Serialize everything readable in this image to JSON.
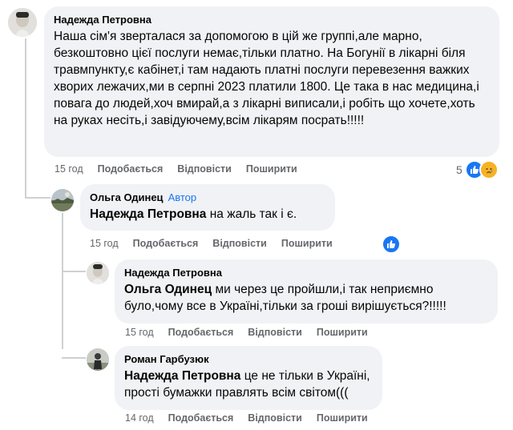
{
  "comments": [
    {
      "author": "Надежда Петровна",
      "text": "Наша сім'я зверталася за допомогою в цій же группі,але марно, безкоштовно цієї послуги немає,тільки платно. На Богунії в лікарні біля травмпункту,є кабінет,і там надають платні послуги перевезення важких хворих лежачих,ми в серпні 2023 платили 1800. Це така в нас медицина,і повага до людей,хоч вмирай,а з лікарні виписали,і робіть що хочете,хоть на руках несіть,і завідуючему,всім лікарям посрать!!!!!",
      "time": "15 год",
      "like": "Подобається",
      "reply": "Відповісти",
      "share": "Поширити",
      "reaction_count": "5"
    },
    {
      "author": "Ольга Одинец",
      "badge": "Автор",
      "mention": "Надежда Петровна",
      "text": " на жаль так і є.",
      "time": "15 год",
      "like": "Подобається",
      "reply": "Відповісти",
      "share": "Поширити"
    },
    {
      "author": "Надежда Петровна",
      "mention": "Ольга Одинец",
      "text": " ми через це пройшли,і так неприємно було,чому все в Україні,тільки за гроші вирішується?!!!!!",
      "time": "15 год",
      "like": "Подобається",
      "reply": "Відповісти",
      "share": "Поширити"
    },
    {
      "author": "Роман Гарбузюк",
      "mention": "Надежда Петровна",
      "text": " це не тільки в Україні, прості бумажки правлять всім світом(((",
      "time": "14 год",
      "like": "Подобається",
      "reply": "Відповісти",
      "share": "Поширити"
    }
  ],
  "colors": {
    "bubble": "#f0f2f5",
    "meta_text": "#65676b",
    "accent": "#1877f2",
    "thread_line": "#ced0d4"
  }
}
